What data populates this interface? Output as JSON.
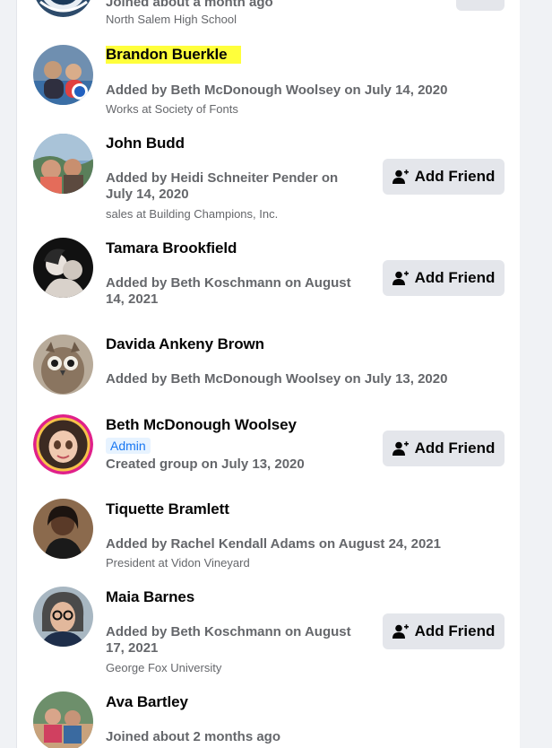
{
  "members": [
    {
      "name": "",
      "detail": "Joined about a month ago",
      "sub": "North Salem High School"
    },
    {
      "name": "Brandon Buerkle",
      "detail": "Added by Beth McDonough Woolsey on July 14, 2020",
      "sub": "Works at Society of Fonts"
    },
    {
      "name": "John Budd",
      "detail": "Added by Heidi Schneiter Pender on July 14, 2020",
      "sub": "sales at Building Champions, Inc.",
      "button": "Add Friend"
    },
    {
      "name": "Tamara Brookfield",
      "detail": "Added by Beth Koschmann on August 14, 2021",
      "button": "Add Friend"
    },
    {
      "name": "Davida Ankeny Brown",
      "detail": "Added by Beth McDonough Woolsey on July 13, 2020"
    },
    {
      "name": "Beth McDonough Woolsey",
      "badge": "Admin",
      "detail": "Created group on July 13, 2020",
      "button": "Add Friend"
    },
    {
      "name": "Tiquette Bramlett",
      "detail": "Added by Rachel Kendall Adams on August 24, 2021",
      "sub": "President at Vidon Vineyard"
    },
    {
      "name": "Maia Barnes",
      "detail": "Added by Beth Koschmann on August 17, 2021",
      "sub": "George Fox University",
      "button": "Add Friend"
    },
    {
      "name": "Ava Bartley",
      "detail": "Joined about 2 months ago"
    }
  ],
  "icons": {
    "add_friend": "add-friend-icon"
  },
  "colors": {
    "highlight": "#ffff3b",
    "admin_badge_bg": "#e7f3ff",
    "admin_badge_text": "#1877f2",
    "button_bg": "#e4e6eb"
  }
}
